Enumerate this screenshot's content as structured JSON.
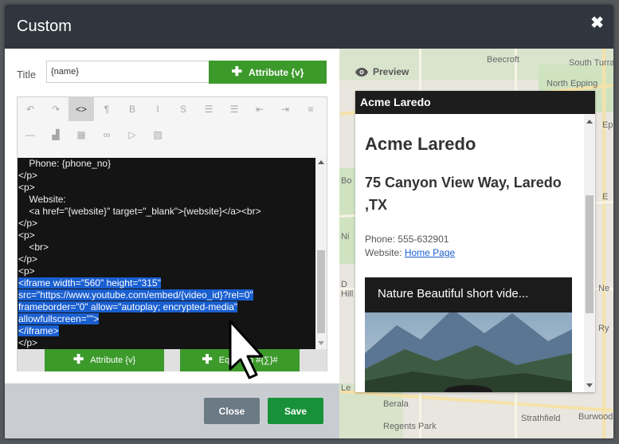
{
  "modal": {
    "title": "Custom"
  },
  "form": {
    "title_label": "Title",
    "title_value": "{name}",
    "attribute_button": "Attribute {v}"
  },
  "editor": {
    "toolbar": [
      {
        "icon": "undo-icon",
        "glyph": "↶"
      },
      {
        "icon": "redo-icon",
        "glyph": "↷"
      },
      {
        "icon": "code-view-icon",
        "glyph": "<>"
      },
      {
        "icon": "paragraph-icon",
        "glyph": "¶"
      },
      {
        "icon": "bold-icon",
        "glyph": "B"
      },
      {
        "icon": "italic-icon",
        "glyph": "I"
      },
      {
        "icon": "strikethrough-icon",
        "glyph": "S"
      },
      {
        "icon": "bullet-list-icon",
        "glyph": "☰"
      },
      {
        "icon": "numbered-list-icon",
        "glyph": "☰"
      },
      {
        "icon": "outdent-icon",
        "glyph": "⇤"
      },
      {
        "icon": "indent-icon",
        "glyph": "⇥"
      },
      {
        "icon": "align-icon",
        "glyph": "≡"
      },
      {
        "icon": "horizontal-rule-icon",
        "glyph": "—"
      },
      {
        "icon": "chart-icon",
        "glyph": "▟"
      },
      {
        "icon": "table-icon",
        "glyph": "▦"
      },
      {
        "icon": "link-icon",
        "glyph": "∞"
      },
      {
        "icon": "video-icon",
        "glyph": "▷"
      },
      {
        "icon": "image-icon",
        "glyph": "▨"
      }
    ],
    "code_lines": [
      {
        "text": "    Phone: {phone_no}",
        "selected": false
      },
      {
        "text": "</p>",
        "selected": false
      },
      {
        "text": "<p>",
        "selected": false
      },
      {
        "text": "    Website:",
        "selected": false
      },
      {
        "text": "    <a href=\"{website}\" target=\"_blank\">{website}</a><br>",
        "selected": false
      },
      {
        "text": "</p>",
        "selected": false
      },
      {
        "text": "<p>",
        "selected": false
      },
      {
        "text": "    <br>",
        "selected": false
      },
      {
        "text": "</p>",
        "selected": false
      },
      {
        "text": "<p>",
        "selected": false
      },
      {
        "text": "<iframe width=\"560\" height=\"315\"",
        "selected": true
      },
      {
        "text": "src=\"https://www.youtube.com/embed/{video_id}?rel=0\"",
        "selected": true
      },
      {
        "text": "frameborder=\"0\" allow=\"autoplay; encrypted-media\"",
        "selected": true
      },
      {
        "text": "allowfullscreen=\"\">",
        "selected": true
      },
      {
        "text": "</iframe>",
        "selected": true
      },
      {
        "text": "</p>",
        "selected": false
      }
    ],
    "attribute_button": "Attribute {v}",
    "equation_button": "Equation #{∑}#"
  },
  "footer": {
    "close_label": "Close",
    "save_label": "Save"
  },
  "preview": {
    "label": "Preview",
    "card_title": "Acme Laredo",
    "name": "Acme Laredo",
    "address": "75 Canyon View Way, Laredo ,TX",
    "phone_label": "Phone:",
    "phone_value": "555-632901",
    "website_label": "Website:",
    "website_link": "Home Page",
    "video_title": "Nature Beautiful short vide..."
  },
  "map_labels": {
    "beecroft": "Beecroft",
    "south_turramurra": "South Turramurra",
    "north_epping": "North Epping",
    "epping": "Epping",
    "bo": "Bo",
    "ni": "Ni",
    "d": "D",
    "hill": "Hill",
    "ne": "Ne",
    "ry": "Ry",
    "le": "Le",
    "berala": "Berala",
    "regents_park": "Regents Park",
    "strathfield": "Strathfield",
    "burwood": "Burwood",
    "e": "E"
  },
  "colors": {
    "header_bg": "#2f363d",
    "green": "#3c9a2b",
    "save_green": "#18913a",
    "close_gray": "#6c7a86",
    "selection": "#1a5fd0"
  }
}
